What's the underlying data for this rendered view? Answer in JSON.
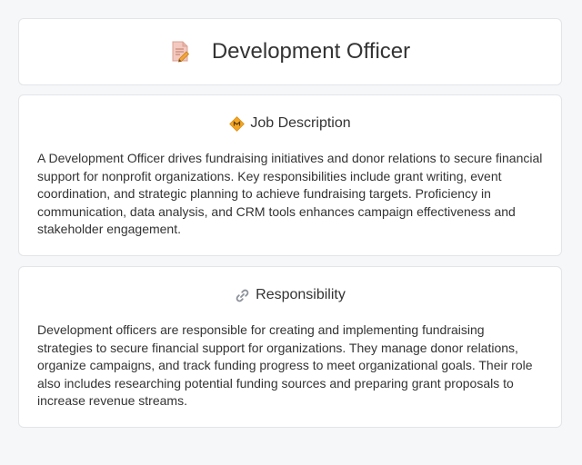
{
  "page": {
    "title": "Development Officer",
    "title_icon": "document-pencil-icon"
  },
  "job_description": {
    "heading": "Job Description",
    "icon": "diamond-badge-icon",
    "body": "A Development Officer drives fundraising initiatives and donor relations to secure financial support for nonprofit organizations. Key responsibilities include grant writing, event coordination, and strategic planning to achieve fundraising targets. Proficiency in communication, data analysis, and CRM tools enhances campaign effectiveness and stakeholder engagement."
  },
  "responsibility": {
    "heading": "Responsibility",
    "icon": "link-icon",
    "body": "Development officers are responsible for creating and implementing fundraising strategies to secure financial support for organizations. They manage donor relations, organize campaigns, and track funding progress to meet organizational goals. Their role also includes researching potential funding sources and preparing grant proposals to increase revenue streams."
  },
  "colors": {
    "background": "#f6f7f9",
    "card": "#ffffff",
    "border": "#e3e5e8",
    "text": "#333333",
    "accent": "#f4a623"
  }
}
